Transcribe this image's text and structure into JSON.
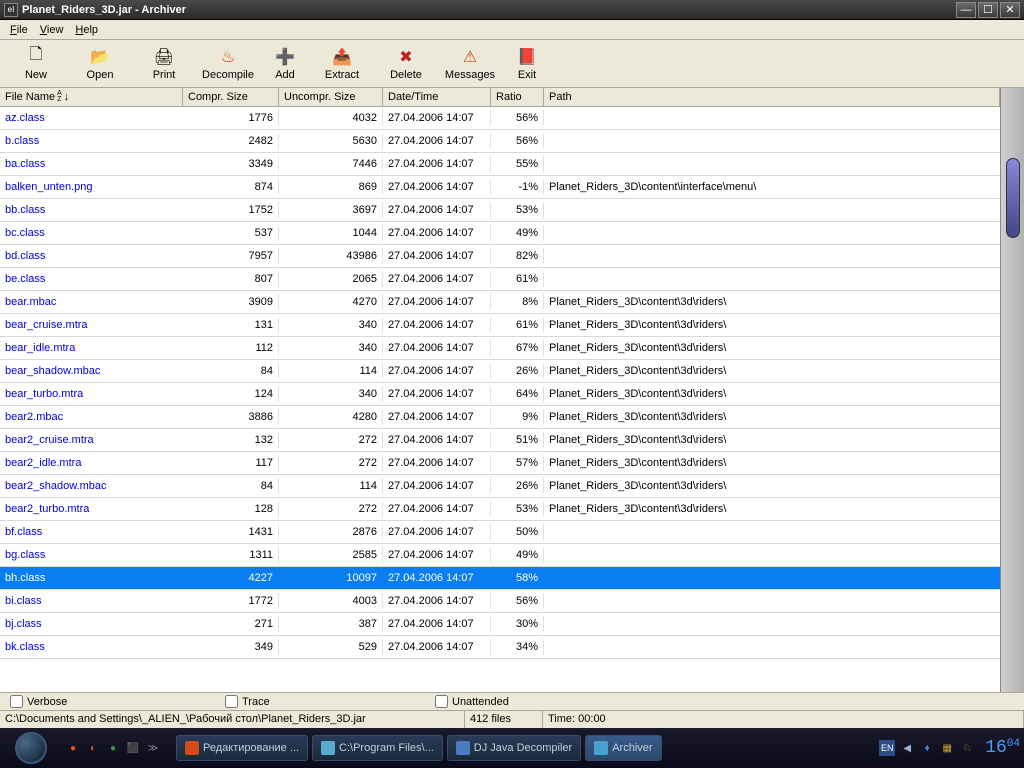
{
  "window": {
    "title": "Planet_Riders_3D.jar - Archiver"
  },
  "menu": {
    "file": "File",
    "view": "View",
    "help": "Help"
  },
  "toolbar": {
    "new": "New",
    "open": "Open",
    "print": "Print",
    "decompile": "Decompile",
    "add": "Add",
    "extract": "Extract",
    "delete": "Delete",
    "messages": "Messages",
    "exit": "Exit"
  },
  "columns": {
    "filename": "File Name",
    "compr": "Compr. Size",
    "uncompr": "Uncompr. Size",
    "datetime": "Date/Time",
    "ratio": "Ratio",
    "path": "Path"
  },
  "rows": [
    {
      "name": "az.class",
      "compr": "1776",
      "uncompr": "4032",
      "dt": "27.04.2006  14:07",
      "ratio": "56%",
      "path": ""
    },
    {
      "name": "b.class",
      "compr": "2482",
      "uncompr": "5630",
      "dt": "27.04.2006  14:07",
      "ratio": "56%",
      "path": ""
    },
    {
      "name": "ba.class",
      "compr": "3349",
      "uncompr": "7446",
      "dt": "27.04.2006  14:07",
      "ratio": "55%",
      "path": ""
    },
    {
      "name": "balken_unten.png",
      "compr": "874",
      "uncompr": "869",
      "dt": "27.04.2006  14:07",
      "ratio": "-1%",
      "path": "Planet_Riders_3D\\content\\interface\\menu\\"
    },
    {
      "name": "bb.class",
      "compr": "1752",
      "uncompr": "3697",
      "dt": "27.04.2006  14:07",
      "ratio": "53%",
      "path": ""
    },
    {
      "name": "bc.class",
      "compr": "537",
      "uncompr": "1044",
      "dt": "27.04.2006  14:07",
      "ratio": "49%",
      "path": ""
    },
    {
      "name": "bd.class",
      "compr": "7957",
      "uncompr": "43986",
      "dt": "27.04.2006  14:07",
      "ratio": "82%",
      "path": ""
    },
    {
      "name": "be.class",
      "compr": "807",
      "uncompr": "2065",
      "dt": "27.04.2006  14:07",
      "ratio": "61%",
      "path": ""
    },
    {
      "name": "bear.mbac",
      "compr": "3909",
      "uncompr": "4270",
      "dt": "27.04.2006  14:07",
      "ratio": "8%",
      "path": "Planet_Riders_3D\\content\\3d\\riders\\"
    },
    {
      "name": "bear_cruise.mtra",
      "compr": "131",
      "uncompr": "340",
      "dt": "27.04.2006  14:07",
      "ratio": "61%",
      "path": "Planet_Riders_3D\\content\\3d\\riders\\"
    },
    {
      "name": "bear_idle.mtra",
      "compr": "112",
      "uncompr": "340",
      "dt": "27.04.2006  14:07",
      "ratio": "67%",
      "path": "Planet_Riders_3D\\content\\3d\\riders\\"
    },
    {
      "name": "bear_shadow.mbac",
      "compr": "84",
      "uncompr": "114",
      "dt": "27.04.2006  14:07",
      "ratio": "26%",
      "path": "Planet_Riders_3D\\content\\3d\\riders\\"
    },
    {
      "name": "bear_turbo.mtra",
      "compr": "124",
      "uncompr": "340",
      "dt": "27.04.2006  14:07",
      "ratio": "64%",
      "path": "Planet_Riders_3D\\content\\3d\\riders\\"
    },
    {
      "name": "bear2.mbac",
      "compr": "3886",
      "uncompr": "4280",
      "dt": "27.04.2006  14:07",
      "ratio": "9%",
      "path": "Planet_Riders_3D\\content\\3d\\riders\\"
    },
    {
      "name": "bear2_cruise.mtra",
      "compr": "132",
      "uncompr": "272",
      "dt": "27.04.2006  14:07",
      "ratio": "51%",
      "path": "Planet_Riders_3D\\content\\3d\\riders\\"
    },
    {
      "name": "bear2_idle.mtra",
      "compr": "117",
      "uncompr": "272",
      "dt": "27.04.2006  14:07",
      "ratio": "57%",
      "path": "Planet_Riders_3D\\content\\3d\\riders\\"
    },
    {
      "name": "bear2_shadow.mbac",
      "compr": "84",
      "uncompr": "114",
      "dt": "27.04.2006  14:07",
      "ratio": "26%",
      "path": "Planet_Riders_3D\\content\\3d\\riders\\"
    },
    {
      "name": "bear2_turbo.mtra",
      "compr": "128",
      "uncompr": "272",
      "dt": "27.04.2006  14:07",
      "ratio": "53%",
      "path": "Planet_Riders_3D\\content\\3d\\riders\\"
    },
    {
      "name": "bf.class",
      "compr": "1431",
      "uncompr": "2876",
      "dt": "27.04.2006  14:07",
      "ratio": "50%",
      "path": ""
    },
    {
      "name": "bg.class",
      "compr": "1311",
      "uncompr": "2585",
      "dt": "27.04.2006  14:07",
      "ratio": "49%",
      "path": ""
    },
    {
      "name": "bh.class",
      "compr": "4227",
      "uncompr": "10097",
      "dt": "27.04.2006  14:07",
      "ratio": "58%",
      "path": "",
      "selected": true
    },
    {
      "name": "bi.class",
      "compr": "1772",
      "uncompr": "4003",
      "dt": "27.04.2006  14:07",
      "ratio": "56%",
      "path": ""
    },
    {
      "name": "bj.class",
      "compr": "271",
      "uncompr": "387",
      "dt": "27.04.2006  14:07",
      "ratio": "30%",
      "path": ""
    },
    {
      "name": "bk.class",
      "compr": "349",
      "uncompr": "529",
      "dt": "27.04.2006  14:07",
      "ratio": "34%",
      "path": ""
    }
  ],
  "options": {
    "verbose": "Verbose",
    "trace": "Trace",
    "unattended": "Unattended"
  },
  "status": {
    "path": "C:\\Documents and Settings\\_ALIEN_\\Рабочий стол\\Planet_Riders_3D.jar",
    "files": "412 files",
    "time": "Time: 00:00"
  },
  "taskbar": {
    "items": [
      {
        "label": "Редактирование ...",
        "color": "#d04a1a"
      },
      {
        "label": "C:\\Program Files\\...",
        "color": "#5aaad0"
      },
      {
        "label": "DJ Java Decompiler",
        "color": "#4a7ac0"
      },
      {
        "label": "Archiver",
        "color": "#4aa0d0",
        "active": true
      }
    ],
    "lang": "EN",
    "time_h": "16",
    "time_m": "04"
  }
}
